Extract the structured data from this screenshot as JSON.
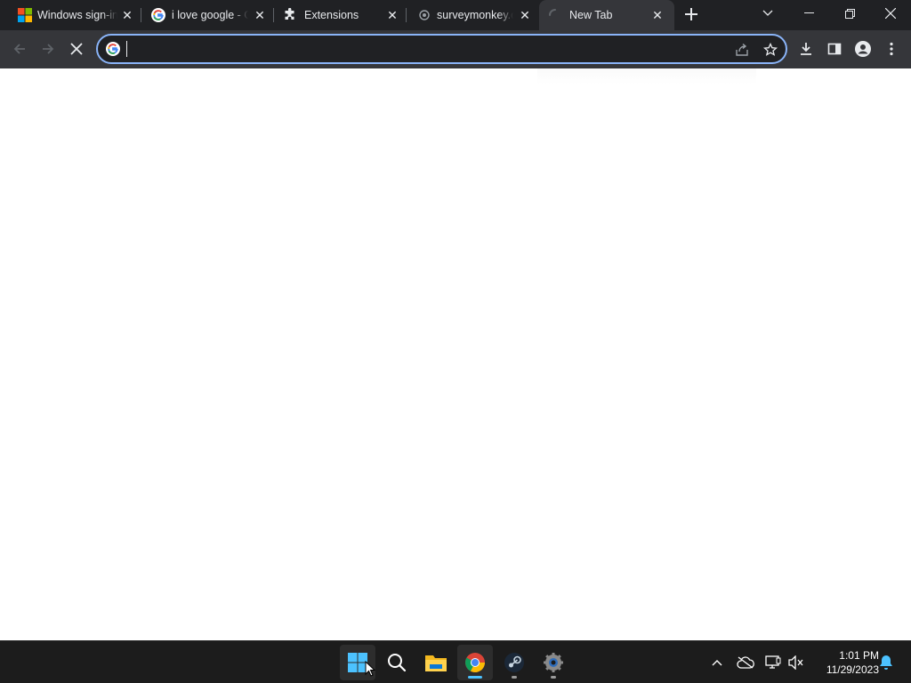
{
  "browser": {
    "tabs": [
      {
        "title": "Windows sign-in",
        "favicon": "microsoft-logo-icon",
        "active": false
      },
      {
        "title": "i love google - Google Search",
        "favicon": "google-g-icon",
        "active": false
      },
      {
        "title": "Extensions",
        "favicon": "puzzle-icon",
        "active": false
      },
      {
        "title": "surveymonkey.com",
        "favicon": "globe-icon",
        "active": false
      },
      {
        "title": "New Tab",
        "favicon": "loading-spinner-icon",
        "active": true
      }
    ],
    "omnibox": {
      "value": "",
      "placeholder": ""
    },
    "colors": {
      "frame": "#202124",
      "toolbar": "#35363a",
      "focus_ring": "#8ab4f8"
    }
  },
  "taskbar": {
    "apps": [
      "start-button",
      "search",
      "file-explorer",
      "chrome",
      "steam",
      "settings"
    ],
    "clock": {
      "time": "1:01 PM",
      "date": "11/29/2023"
    }
  }
}
